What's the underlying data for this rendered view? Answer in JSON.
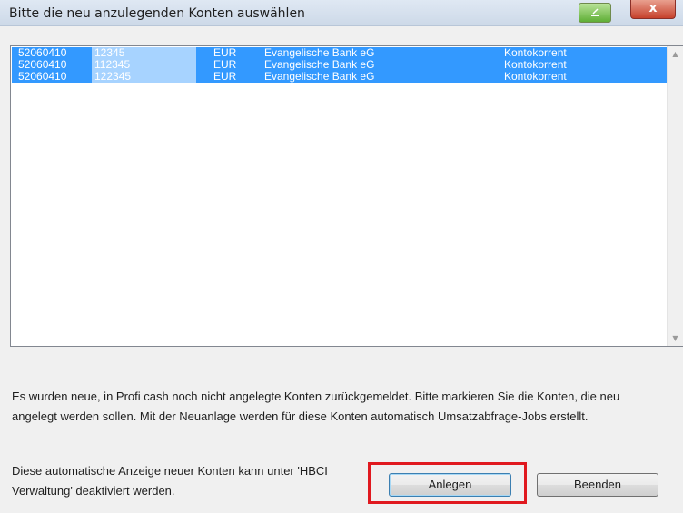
{
  "window": {
    "title": "Bitte die neu anzulegenden Konten auswählen",
    "close_label": "x"
  },
  "accounts": [
    {
      "blz": "52060410",
      "konto": "12345",
      "waehrung": "EUR",
      "bank": "Evangelische Bank eG",
      "art": "Kontokorrent",
      "selected": true
    },
    {
      "blz": "52060410",
      "konto": "112345",
      "waehrung": "EUR",
      "bank": "Evangelische Bank eG",
      "art": "Kontokorrent",
      "selected": true
    },
    {
      "blz": "52060410",
      "konto": "122345",
      "waehrung": "EUR",
      "bank": "Evangelische Bank eG",
      "art": "Kontokorrent",
      "selected": true
    }
  ],
  "info_text": "Es wurden neue, in Profi cash noch nicht angelegte Konten zurückgemeldet. Bitte markieren Sie die Konten, die neu angelegt werden sollen. Mit der Neuanlage werden für diese Konten automatisch Umsatzabfrage-Jobs erstellt.",
  "hint_text": "Diese automatische Anzeige neuer Konten kann unter 'HBCI Verwaltung' deaktiviert werden.",
  "buttons": {
    "create_label": "Anlegen",
    "exit_label": "Beenden"
  },
  "colors": {
    "selection": "#3399ff",
    "highlight_border": "#e0191f"
  }
}
